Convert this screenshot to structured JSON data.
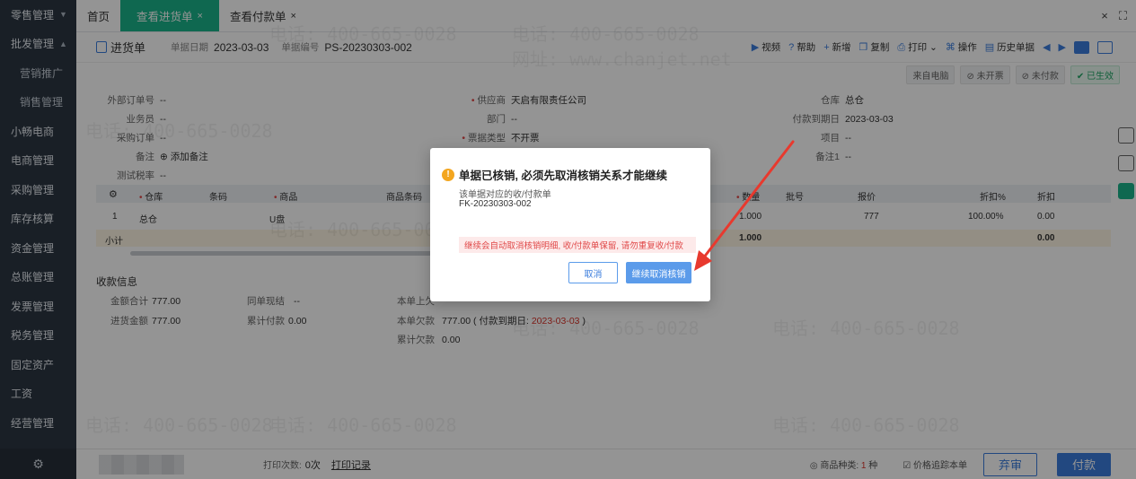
{
  "sidebar": {
    "items": [
      {
        "label": "零售管理",
        "arrow": "▼"
      },
      {
        "label": "批发管理",
        "arrow": "▲"
      },
      {
        "label": "营销推广"
      },
      {
        "label": "销售管理"
      },
      {
        "label": "小畅电商"
      },
      {
        "label": "电商管理"
      },
      {
        "label": "采购管理"
      },
      {
        "label": "库存核算"
      },
      {
        "label": "资金管理"
      },
      {
        "label": "总账管理"
      },
      {
        "label": "发票管理"
      },
      {
        "label": "税务管理"
      },
      {
        "label": "固定资产"
      },
      {
        "label": "工资"
      },
      {
        "label": "经营管理"
      }
    ],
    "gear": "⚙"
  },
  "tabs": {
    "home": "首页",
    "t1": "查看进货单",
    "t2": "查看付款单",
    "close": "×"
  },
  "toolbar": {
    "doc_type": "进货单",
    "date_label": "单据日期",
    "date": "2023-03-03",
    "no_label": "单据编号",
    "no": "PS-20230303-002",
    "video": "视频",
    "help": "帮助",
    "new": "新增",
    "copy": "复制",
    "print": "打印",
    "action": "操作",
    "history": "历史单据"
  },
  "status": {
    "source": "来自电脑",
    "invoice": "未开票",
    "paid": "未付款",
    "effective": "已生效"
  },
  "form": {
    "ext_order_label": "外部订单号",
    "ext_order": "--",
    "staff_label": "业务员",
    "staff": "--",
    "po_label": "采购订单",
    "po": "--",
    "note_label": "备注",
    "note_link": "添加备注",
    "tax_label": "测试税率",
    "tax": "--",
    "supplier_label": "供应商",
    "supplier": "天启有限责任公司",
    "dept_label": "部门",
    "dept": "--",
    "bill_type_label": "票据类型",
    "bill_type": "不开票",
    "wh_label": "仓库",
    "wh": "总仓",
    "due_label": "付款到期日",
    "due": "2023-03-03",
    "project_label": "项目",
    "project": "--",
    "note1_label": "备注1",
    "note1": "--"
  },
  "table": {
    "headers": {
      "wh": "仓库",
      "barcode": "条码",
      "goods": "商品",
      "goods_code": "商品条码",
      "qty": "数量",
      "batch": "批号",
      "price": "报价",
      "discount_pct": "折扣%",
      "discount": "折扣"
    },
    "row": {
      "idx": "1",
      "wh": "总仓",
      "goods": "U盘",
      "qty": "1.000",
      "price": "777",
      "discount_pct": "100.00%",
      "discount": "0.00"
    },
    "subtotal": {
      "label": "小计",
      "qty": "1.000",
      "discount": "0.00"
    }
  },
  "payment": {
    "title": "收款信息",
    "total_label": "金额合计",
    "total": "777.00",
    "cash_label": "同单现结",
    "cash": "--",
    "last_label": "本单上欠",
    "purchase_label": "进货金额",
    "purchase": "777.00",
    "cum_paid_label": "累计付款",
    "cum_paid": "0.00",
    "owed_label": "本单欠款",
    "owed": "777.00",
    "owed_due_prefix": "( 付款到期日:",
    "owed_due": "2023-03-03",
    "owed_due_suffix": ")",
    "cum_owed_label": "累计欠款",
    "cum_owed": "0.00"
  },
  "bottom": {
    "print_count_label": "打印次数:",
    "print_count": "0次",
    "print_log": "打印记录",
    "kinds_label": "商品种类:",
    "kinds": "1",
    "kinds_unit": "种",
    "trace_label": "价格追踪本单",
    "abandon": "弃审",
    "pay": "付款"
  },
  "watermark": {
    "phone": "电话: 400-665-0028",
    "site": "网址: www.chanjet.net"
  },
  "modal": {
    "title": "单据已核销, 必须先取消核销关系才能继续",
    "desc": "该单据对应的收/付款单",
    "code": "FK-20230303-002",
    "alert": "继续会自动取消核销明细, 收/付款单保留, 请勿重复收/付款",
    "cancel": "取消",
    "confirm": "继续取消核销"
  },
  "colors": {
    "accent": "#3b7ddd",
    "tab_active": "#1bb38a",
    "arrow": "#e8392e"
  }
}
